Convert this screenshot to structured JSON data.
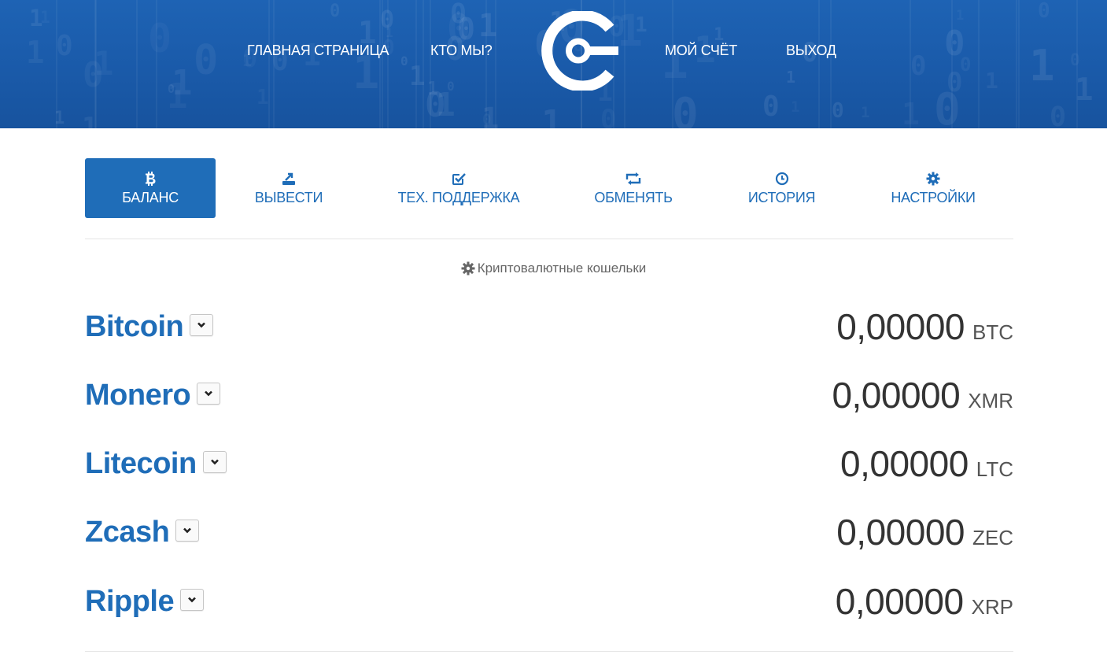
{
  "header": {
    "nav_left": [
      "ГЛАВНАЯ СТРАНИЦА",
      "КТО МЫ?"
    ],
    "nav_right": [
      "МОЙ СЧЁТ",
      "ВЫХОД"
    ],
    "logo_icon": "brand-logo-icon",
    "background_color": "#1a5aa9"
  },
  "tabs": [
    {
      "label": "БАЛАНС",
      "icon": "bitcoin-icon",
      "active": true
    },
    {
      "label": "ВЫВЕСТИ",
      "icon": "withdraw-icon",
      "active": false
    },
    {
      "label": "ТЕХ. ПОДДЕРЖКА",
      "icon": "check-square-icon",
      "active": false
    },
    {
      "label": "ОБМЕНЯТЬ",
      "icon": "exchange-icon",
      "active": false
    },
    {
      "label": "ИСТОРИЯ",
      "icon": "clock-icon",
      "active": false
    },
    {
      "label": "НАСТРОЙКИ",
      "icon": "gear-icon",
      "active": false
    }
  ],
  "section": {
    "title": "Криптовалютные кошельки",
    "icon": "gear-icon"
  },
  "wallets": [
    {
      "name": "Bitcoin",
      "amount": "0,00000",
      "currency": "BTC"
    },
    {
      "name": "Monero",
      "amount": "0,00000",
      "currency": "XMR"
    },
    {
      "name": "Litecoin",
      "amount": "0,00000",
      "currency": "LTC"
    },
    {
      "name": "Zcash",
      "amount": "0,00000",
      "currency": "ZEC"
    },
    {
      "name": "Ripple",
      "amount": "0,00000",
      "currency": "XRP"
    }
  ],
  "colors": {
    "accent": "#1f6db8",
    "header": "#1a5aa9",
    "amount_text": "#333333"
  }
}
